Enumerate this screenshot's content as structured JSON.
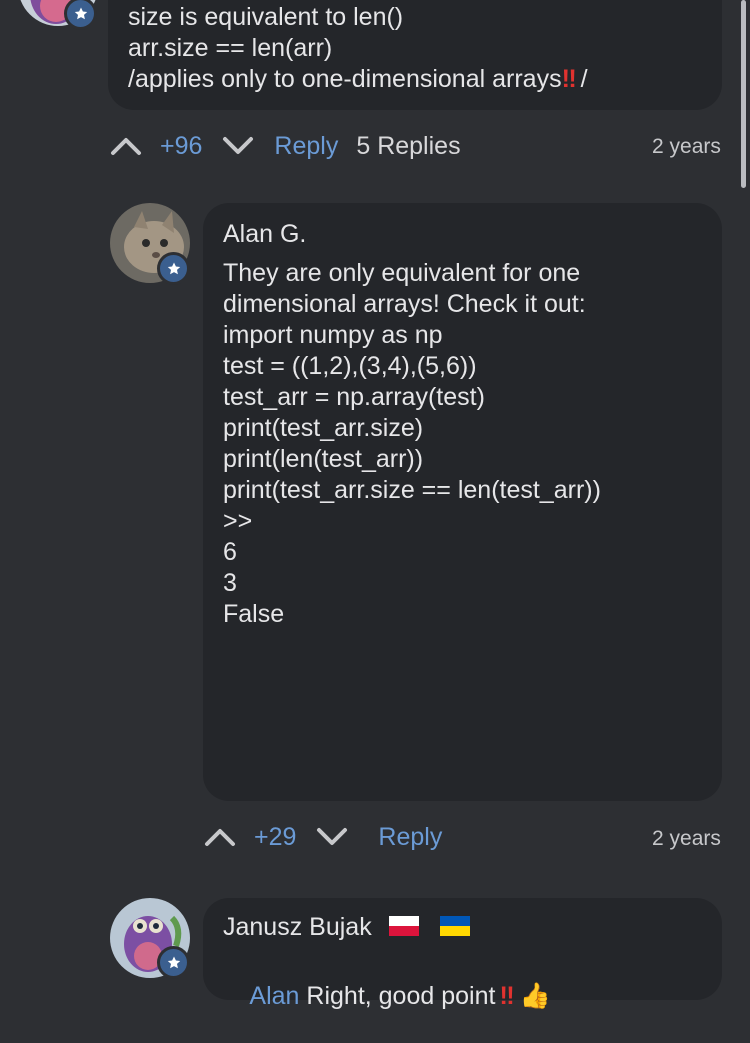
{
  "comment_top": {
    "lines": [
      "size is equivalent to len()",
      "arr.size == len(arr)"
    ],
    "line3_prefix": "/applies only to one-dimensional arrays",
    "line3_emoji": "‼",
    "line3_suffix": " /",
    "upvote_icon": "chevron-up-icon",
    "score": "+96",
    "downvote_icon": "chevron-down-icon",
    "reply_label": "Reply",
    "replies_label": "5 Replies",
    "time": "2 years"
  },
  "comment_alan": {
    "author": "Alan G.",
    "body_lines": [
      "They are only equivalent for one",
      "dimensional arrays! Check it out:",
      "",
      "import numpy as np",
      "",
      "test = ((1,2),(3,4),(5,6))",
      "",
      "test_arr = np.array(test)",
      "",
      "print(test_arr.size)",
      "print(len(test_arr))",
      "print(test_arr.size == len(test_arr))",
      "",
      ">>",
      "6",
      "3",
      "False"
    ],
    "score": "+29",
    "reply_label": "Reply",
    "time": "2 years"
  },
  "comment_janusz": {
    "author": "Janusz Bujak",
    "flags": [
      "poland-flag",
      "ukraine-flag"
    ],
    "mention": "Alan",
    "text": " Right, good point",
    "emoji_excl": "‼",
    "emoji_thumb": "👍"
  },
  "colors": {
    "background": "#2d2f33",
    "bubble": "#24262a",
    "link": "#6b9bd6",
    "badge": "#3b5f8f"
  }
}
